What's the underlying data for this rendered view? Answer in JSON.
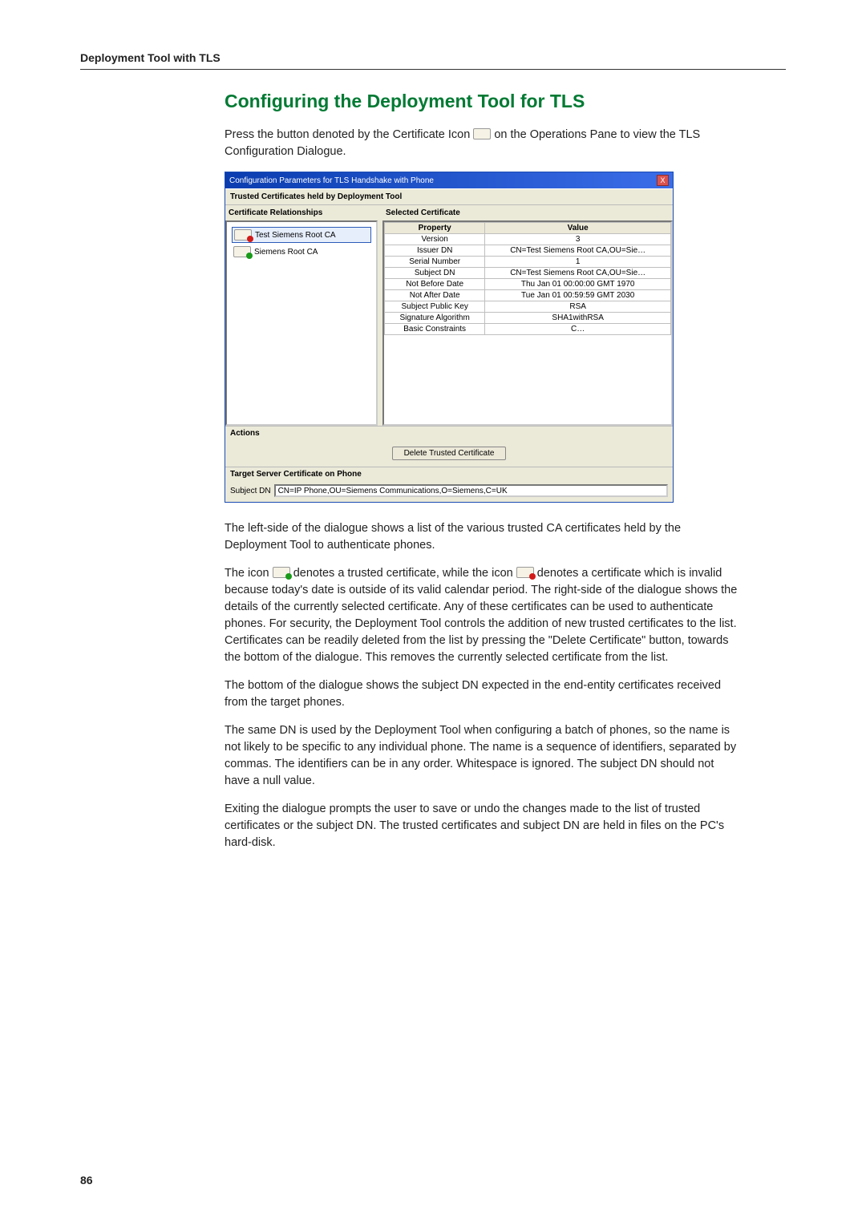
{
  "running_head": "Deployment Tool with TLS",
  "heading": "Configuring the Deployment Tool for TLS",
  "intro": "Press the button denoted by the Certificate Icon ",
  "intro_tail": " on the Operations Pane to view the TLS Configuration Dialogue.",
  "dialog": {
    "title": "Configuration Parameters for TLS Handshake with Phone",
    "close": "X",
    "section1": "Trusted Certificates held by Deployment Tool",
    "left_header": "Certificate Relationships",
    "right_header": "Selected Certificate",
    "items": [
      {
        "name": "Test Siemens Root CA",
        "selected": true,
        "valid": false
      },
      {
        "name": "Siemens Root CA",
        "selected": false,
        "valid": true
      }
    ],
    "props_header": {
      "p": "Property",
      "v": "Value"
    },
    "props": [
      {
        "p": "Version",
        "v": "3"
      },
      {
        "p": "Issuer DN",
        "v": "CN=Test Siemens Root CA,OU=Sie…"
      },
      {
        "p": "Serial Number",
        "v": "1"
      },
      {
        "p": "Subject DN",
        "v": "CN=Test Siemens Root CA,OU=Sie…"
      },
      {
        "p": "Not Before Date",
        "v": "Thu Jan 01 00:00:00 GMT 1970"
      },
      {
        "p": "Not After Date",
        "v": "Tue Jan 01 00:59:59 GMT 2030"
      },
      {
        "p": "Subject Public Key",
        "v": "RSA"
      },
      {
        "p": "Signature Algorithm",
        "v": "SHA1withRSA"
      },
      {
        "p": "Basic Constraints",
        "v": "C…"
      }
    ],
    "actions_label": "Actions",
    "delete_btn": "Delete Trusted Certificate",
    "target_label": "Target Server Certificate on Phone",
    "subject_dn_label": "Subject DN",
    "subject_dn_value": "CN=IP Phone,OU=Siemens Communications,O=Siemens,C=UK"
  },
  "p_leftside": "The left-side of the dialogue shows a list of the various trusted CA certificates held by the Deployment Tool to authenticate phones.",
  "p_icon_a": "The icon ",
  "p_icon_b": " denotes a trusted certificate, while the icon ",
  "p_icon_c": " denotes a certificate which is invalid because today's date is outside of its valid calendar period. The right-side of the dialogue shows the details of the currently selected certificate.  Any of these certificates can be used to authenticate phones.  For security, the Deployment Tool controls the addition of new trusted certificates to the list.  Certificates can be readily deleted from the list by pressing the \"Delete Certificate\" button, towards the bottom of the dialogue.  This removes the currently selected certificate from the list.",
  "p_bottom": "The bottom of the dialogue shows the subject DN expected in the end-entity certificates received from the target phones.",
  "p_samedn": "The same DN is used by the Deployment Tool when configuring a batch of phones, so the name is not likely to be specific to any individual phone.  The name is a sequence of identifiers, separated by commas.  The identifiers can be in any order.  Whitespace is ignored.  The subject DN should not have a null value.",
  "p_exit": "Exiting the dialogue prompts the user to save or undo the changes made to the list of trusted certificates or the subject DN.  The trusted certificates and subject DN are held in files on the PC's hard-disk.",
  "pagenum": "86"
}
